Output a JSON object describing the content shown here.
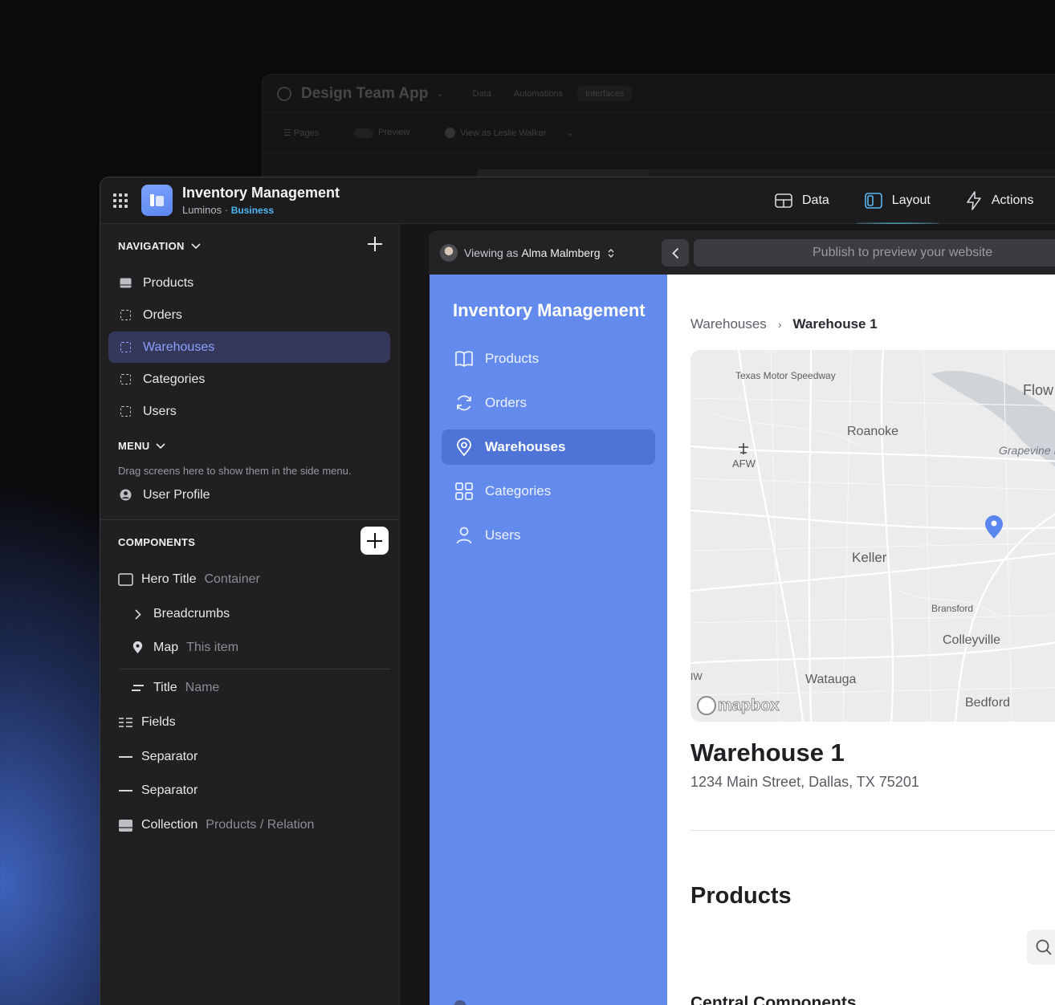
{
  "background_window": {
    "title": "Design Team App",
    "tabs": [
      "Data",
      "Automations",
      "Interfaces"
    ],
    "toolbar": {
      "pages": "Pages",
      "preview": "Preview",
      "view_as": "View as Leslie Walker"
    }
  },
  "app": {
    "title": "Inventory Management",
    "org": "Luminos",
    "plan": "Business",
    "accent_color": "#638bee"
  },
  "top_nav": {
    "data": "Data",
    "layout": "Layout",
    "actions": "Actions"
  },
  "navigation": {
    "heading": "NAVIGATION",
    "items": [
      {
        "label": "Products",
        "icon": "table-icon"
      },
      {
        "label": "Orders",
        "icon": "screen-icon"
      },
      {
        "label": "Warehouses",
        "icon": "screen-icon",
        "active": true
      },
      {
        "label": "Categories",
        "icon": "screen-icon"
      },
      {
        "label": "Users",
        "icon": "screen-icon"
      }
    ]
  },
  "menu": {
    "heading": "MENU",
    "hint": "Drag screens here to show them in the side menu.",
    "items": [
      {
        "label": "User Profile",
        "icon": "user-icon"
      }
    ]
  },
  "components": {
    "heading": "COMPONENTS",
    "items": [
      {
        "label": "Hero Title",
        "sub": "Container"
      },
      {
        "label": "Breadcrumbs",
        "sub": ""
      },
      {
        "label": "Map",
        "sub": "This item"
      },
      {
        "label": "Title",
        "sub": "Name"
      },
      {
        "label": "Fields",
        "sub": ""
      },
      {
        "label": "Separator",
        "sub": ""
      },
      {
        "label": "Separator",
        "sub": ""
      },
      {
        "label": "Collection",
        "sub": "Products / Relation"
      }
    ]
  },
  "preview": {
    "viewing_prefix": "Viewing as",
    "viewing_user": "Alma Malmberg",
    "url_placeholder": "Publish to preview your website"
  },
  "site": {
    "title": "Inventory Management",
    "nav": [
      {
        "label": "Products",
        "icon": "book-icon"
      },
      {
        "label": "Orders",
        "icon": "refresh-icon"
      },
      {
        "label": "Warehouses",
        "icon": "location-pin-icon",
        "active": true
      },
      {
        "label": "Categories",
        "icon": "grid-icon"
      },
      {
        "label": "Users",
        "icon": "user-icon"
      }
    ],
    "breadcrumbs": [
      "Warehouses",
      "Warehouse 1"
    ],
    "map_labels": {
      "speedway": "Texas Motor Speedway",
      "flow": "Flow",
      "roanoke": "Roanoke",
      "afw": "AFW",
      "grapevine": "Grapevine L",
      "keller": "Keller",
      "bransford": "Bransford",
      "colleyville": "Colleyville",
      "iw": "IW",
      "watauga": "Watauga",
      "bedford": "Bedford",
      "mapbox": "mapbox"
    },
    "warehouse_name": "Warehouse 1",
    "warehouse_address": "1234 Main Street, Dallas, TX 75201",
    "products_heading": "Products",
    "subsection_heading": "Central Components"
  }
}
